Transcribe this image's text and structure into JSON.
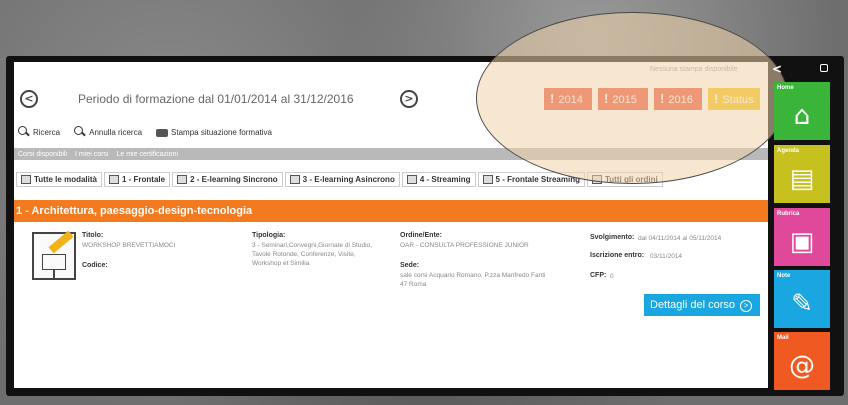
{
  "header": {
    "period_title": "Periodo di formazione dal 01/01/2014 al 31/12/2016",
    "no_print": "Nessuna stampa disponibile",
    "prev_icon": "arrow-left-circle-icon",
    "next_icon": "arrow-right-circle-icon"
  },
  "year_buttons": [
    {
      "bang": "!",
      "label": "2014"
    },
    {
      "bang": "!",
      "label": "2015"
    },
    {
      "bang": "!",
      "label": "2016"
    },
    {
      "bang": "!",
      "label": "Status"
    }
  ],
  "toolbar": {
    "search": "Ricerca",
    "cancel_search": "Annulla ricerca",
    "print": "Stampa situazione formativa"
  },
  "strip_tabs": [
    "Corsi disponibili",
    "I miei corsi",
    "Le mie certificazioni"
  ],
  "modes": [
    "Tutte le modalità",
    "1 - Frontale",
    "2 - E-learning Sincrono",
    "3 - E-learning Asincrono",
    "4 - Streaming",
    "5 - Frontale Streaming",
    "Tutti gli ordini"
  ],
  "category": "1 - Architettura, paesaggio-design-tecnologia",
  "course": {
    "titolo_label": "Titolo:",
    "titolo_value": "WORKSHOP BREVETTIAMOCI",
    "codice_label": "Codice:",
    "tipologia_label": "Tipologia:",
    "tipologia_value_1": "3 - Seminari,Convegni,Giornate di Studio,",
    "tipologia_value_2": "Tavole Rotonde, Conferenze, Visite,",
    "tipologia_value_3": "Workshop et Similia",
    "ordine_label": "Ordine/Ente:",
    "ordine_value": "OAR - CONSULTA PROFESSIONE JUNIOR",
    "sede_label": "Sede:",
    "sede_value_1": "sale corsi Acquario Romano, P.zza Manfredo Fanti",
    "sede_value_2": "47 Roma",
    "svolgimento_label": "Svolgimento:",
    "svolgimento_value": "dal 04/11/2014 al 05/11/2014",
    "iscrizione_label": "Iscrizione entro:",
    "iscrizione_value": "03/11/2014",
    "cfp_label": "CFP:",
    "cfp_value": "0",
    "details_button": "Dettagli del corso"
  },
  "sidebar": {
    "tiles": [
      {
        "label": "Home",
        "icon": "home-icon",
        "color": "#3ab53a"
      },
      {
        "label": "Agenda",
        "icon": "notebook-icon",
        "color": "#c6c11e"
      },
      {
        "label": "Rubrica",
        "icon": "contact-card-icon",
        "color": "#e0489a"
      },
      {
        "label": "Note",
        "icon": "note-pen-icon",
        "color": "#1aa6e0"
      },
      {
        "label": "Mail",
        "icon": "at-sign-icon",
        "color": "#f05a22"
      }
    ]
  },
  "colors": {
    "year_red": "#e8503a",
    "status_yellow": "#f2c010",
    "category_orange": "#f47a20",
    "details_blue": "#1aa6e0"
  }
}
